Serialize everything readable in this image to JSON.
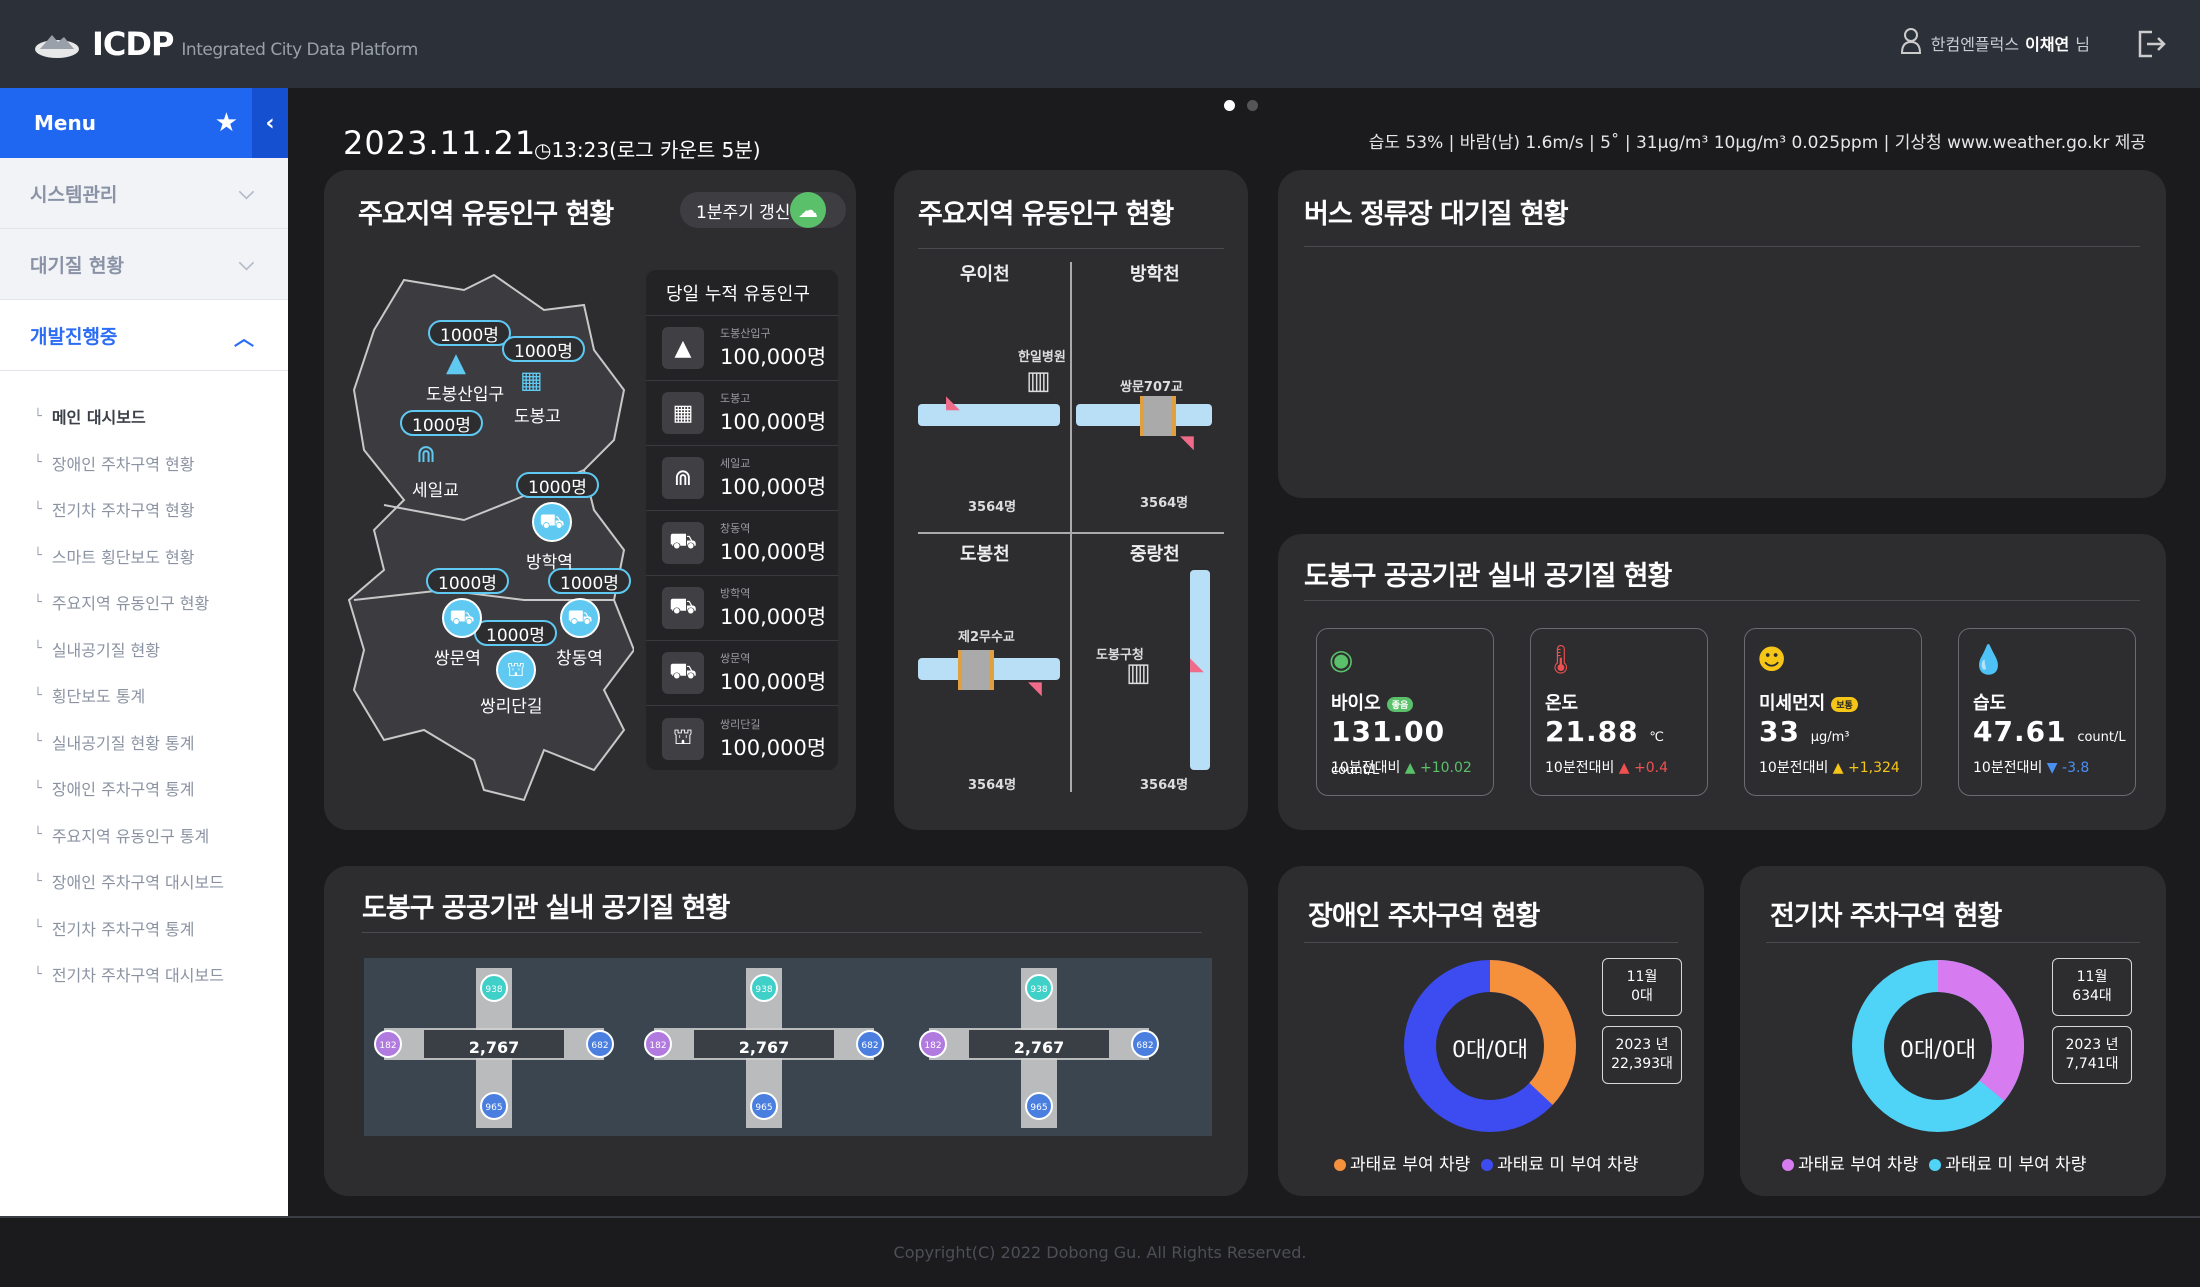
{
  "app": {
    "logo": "ICDP",
    "logo_sub": "Integrated City Data Platform"
  },
  "user": {
    "org": "한컴엔플럭스",
    "name": "이채연",
    "suffix": "님"
  },
  "sidebar": {
    "menu_label": "Menu",
    "groups": [
      {
        "label": "시스템관리"
      },
      {
        "label": "대기질 현황"
      },
      {
        "label": "개발진행중"
      }
    ],
    "items": [
      "메인 대시보드",
      "장애인 주차구역 현황",
      "전기차 주차구역 현황",
      "스마트 횡단보도 현황",
      "주요지역 유동인구 현황",
      "실내공기질 현황",
      "횡단보도 통계",
      "실내공기질 현황 통계",
      "장애인 주차구역 통계",
      "주요지역 유동인구 통계",
      "장애인 주차구역 대시보드",
      "전기차 주차구역 통계",
      "전기차 주차구역 대시보드"
    ]
  },
  "header": {
    "date": "2023.11.21",
    "time": "13:23(로그 카운트 5분)",
    "weather": "습도 53% | 바람(남) 1.6m/s | 5˚ | 31μg/m³ 10μg/m³ 0.025ppm | 기상청 www.weather.go.kr 제공"
  },
  "footprint": {
    "title": "주요지역 유동인구 현황",
    "refresh": "1분주기 갱신",
    "list_title": "당일 누적 유동인구",
    "rows": [
      {
        "name": "도봉산입구",
        "value": "100,000명",
        "icon": "mountain-icon"
      },
      {
        "name": "도봉고",
        "value": "100,000명",
        "icon": "school-icon"
      },
      {
        "name": "세일교",
        "value": "100,000명",
        "icon": "bridge-icon"
      },
      {
        "name": "창동역",
        "value": "100,000명",
        "icon": "train-icon"
      },
      {
        "name": "방학역",
        "value": "100,000명",
        "icon": "train-icon"
      },
      {
        "name": "쌍문역",
        "value": "100,000명",
        "icon": "train-icon"
      },
      {
        "name": "쌍리단길",
        "value": "100,000명",
        "icon": "shop-icon"
      }
    ],
    "pins": [
      "1000명",
      "1000명",
      "1000명",
      "1000명",
      "1000명",
      "1000명",
      "1000명"
    ],
    "places": [
      "도봉산입구",
      "도봉고",
      "세일교",
      "방학역",
      "쌍문역",
      "창동역",
      "쌍리단길"
    ]
  },
  "streams": {
    "title": "주요지역 유동인구 현황",
    "labels": [
      "우이천",
      "방학천",
      "도봉천",
      "중랑천"
    ],
    "landmarks": [
      "한일병원",
      "쌍문707교",
      "제2무수교",
      "도봉구청"
    ],
    "counts": [
      "3564명",
      "3564명",
      "3564명",
      "3564명"
    ]
  },
  "bus": {
    "title": "버스 정류장 대기질 현황"
  },
  "indoor": {
    "title": "도봉구 공공기관 실내 공기질 현황",
    "cards": [
      {
        "name": "바이오",
        "tag": "좋음",
        "value": "131.00",
        "unit": "count/L",
        "cmp_label": "10분전대비",
        "delta": "▲ +10.02",
        "color": "#5ac06a",
        "icon": "bio-icon"
      },
      {
        "name": "온도",
        "tag": "",
        "value": "21.88",
        "unit": "℃",
        "cmp_label": "10분전대비",
        "delta": "▲ +0.4",
        "color": "#f05050",
        "icon": "thermometer-icon"
      },
      {
        "name": "미세먼지",
        "tag": "보통",
        "value": "33",
        "unit": "μg/m³",
        "cmp_label": "10분전대비",
        "delta": "▲ +1,324",
        "color": "#f5c518",
        "icon": "smile-icon"
      },
      {
        "name": "습도",
        "tag": "",
        "value": "47.61",
        "unit": "count/L",
        "cmp_label": "10분전대비",
        "delta": "▼ -3.8",
        "color": "#4a90f0",
        "icon": "drops-icon"
      }
    ]
  },
  "cctv": {
    "title": "도봉구 공공기관 실내 공기질 현황",
    "feeds": [
      {
        "total": "2,767",
        "n": "938",
        "w": "182",
        "e": "682",
        "s": "965"
      },
      {
        "total": "2,767",
        "n": "938",
        "w": "182",
        "e": "682",
        "s": "965"
      },
      {
        "total": "2,767",
        "n": "938",
        "w": "182",
        "e": "682",
        "s": "965"
      }
    ]
  },
  "disabled": {
    "title": "장애인 주차구역 현황",
    "center": "0대/0대",
    "box1": [
      "11월",
      "0대"
    ],
    "box2": [
      "2023 년",
      "22,393대"
    ],
    "legend": [
      "과태료 부여 차량",
      "과태료 미 부여 차량"
    ],
    "colors": [
      "#f5903d",
      "#3d4cf0"
    ],
    "share": [
      0.37,
      0.63
    ]
  },
  "ev": {
    "title": "전기차 주차구역 현황",
    "center": "0대/0대",
    "box1": [
      "11월",
      "634대"
    ],
    "box2": [
      "2023 년",
      "7,741대"
    ],
    "legend": [
      "과태료 부여 차량",
      "과태료 미 부여 차량"
    ],
    "colors": [
      "#d77cf0",
      "#4fd3f6"
    ],
    "share": [
      0.36,
      0.64
    ]
  },
  "footer": "Copyright(C) 2022 Dobong Gu. All Rights Reserved."
}
